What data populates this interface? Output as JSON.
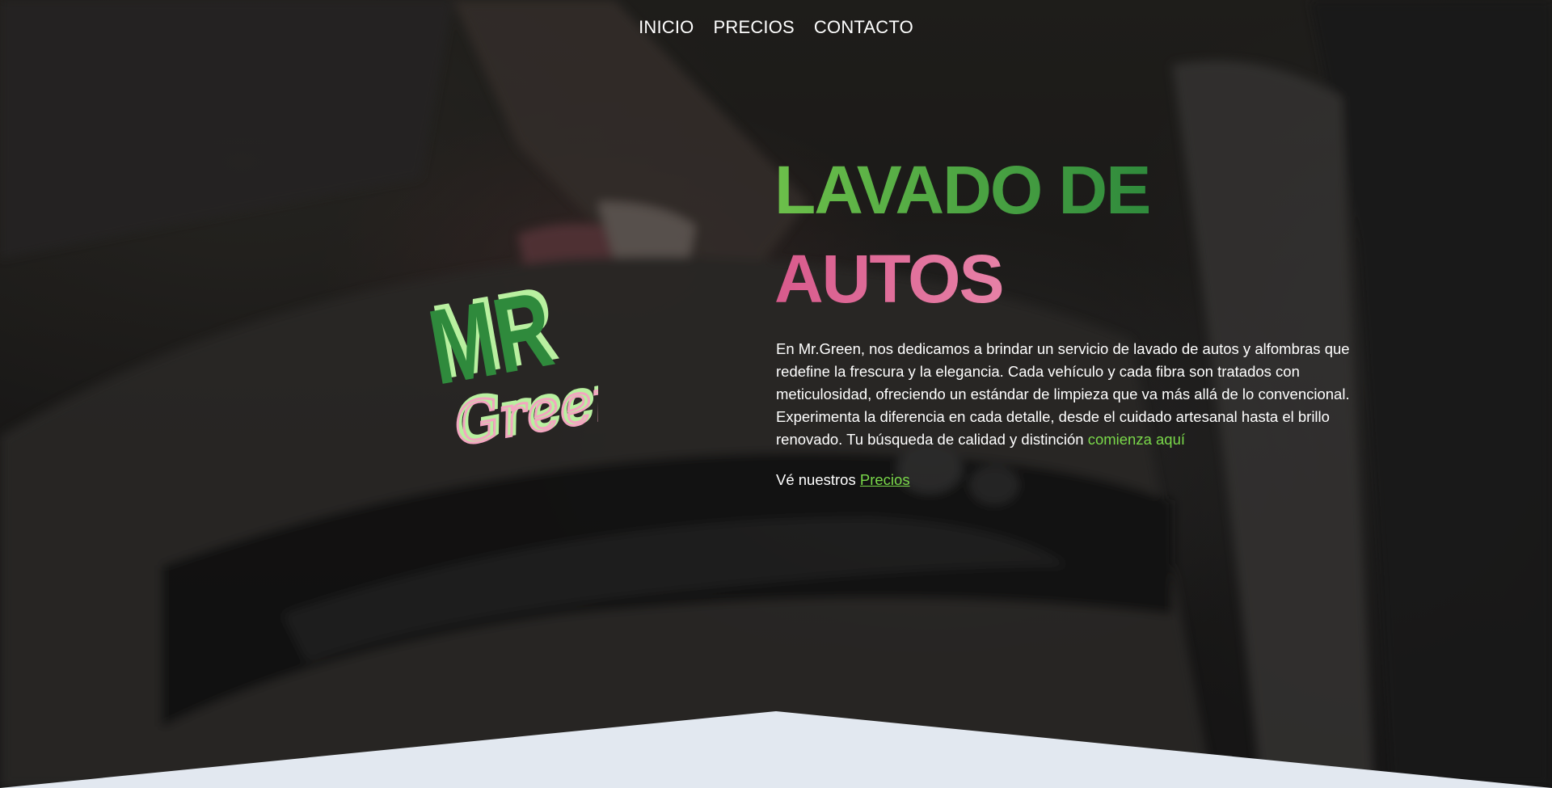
{
  "nav": {
    "items": [
      {
        "label": "INICIO"
      },
      {
        "label": "PRECIOS"
      },
      {
        "label": "CONTACTO"
      }
    ]
  },
  "logo": {
    "brand_top": "MR",
    "brand_bottom": "Green",
    "green": "#2f8a3c",
    "pink": "#f2a6c0",
    "light_green": "#b9f0a0"
  },
  "hero": {
    "title_line1": "LAVADO DE",
    "title_line2": "AUTOS",
    "description": "En Mr.Green, nos dedicamos a brindar un servicio de lavado de autos y alfombras que redefine la frescura y la elegancia. Cada vehículo y cada fibra son tratados con meticulosidad, ofreciendo un estándar de limpieza que va más allá de lo convencional. Experimenta la diferencia en cada detalle, desde el cuidado artesanal hasta el brillo renovado. Tu búsqueda de calidad y distinción",
    "description_accent": "comienza aquí",
    "cta_prefix": "Vé nuestros",
    "cta_link": "Precios"
  },
  "colors": {
    "accent_green": "#7ad94a",
    "title_green": "#5cb83a",
    "title_pink": "#e07aa0",
    "bottom_section": "#e2e8f0"
  }
}
